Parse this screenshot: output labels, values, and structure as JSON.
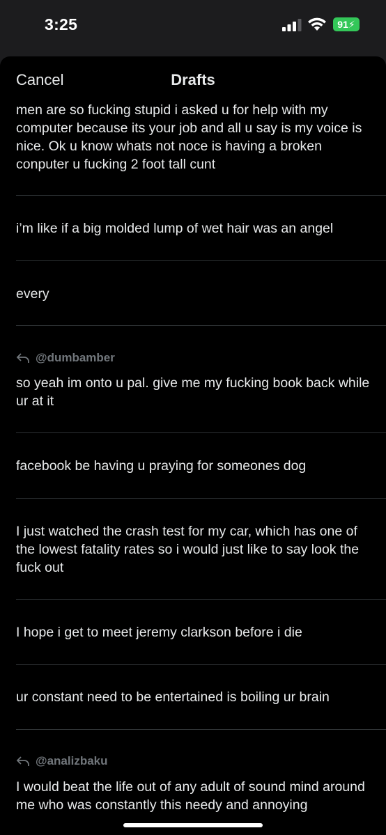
{
  "status_bar": {
    "time": "3:25",
    "battery": "91"
  },
  "nav": {
    "cancel_label": "Cancel",
    "title": "Drafts"
  },
  "drafts": [
    {
      "text": "men are so fucking stupid i asked u for help with my computer because its your job and all u say is my voice is nice. Ok u know whats not noce is having a broken conputer u fucking 2 foot tall cunt"
    },
    {
      "text": "i’m like if a big molded lump of wet hair was an angel"
    },
    {
      "text": "every"
    },
    {
      "reply_to": "@dumbamber",
      "text": "so yeah im onto u pal.  give me my fucking book back while ur at it"
    },
    {
      "text": "facebook be having u praying for someones dog"
    },
    {
      "text": "I just watched the crash test for my car, which has one of the lowest fatality rates so i would just like to say look the fuck out"
    },
    {
      "text": "I hope i get to meet jeremy clarkson before i die"
    },
    {
      "text": "ur constant need to be entertained is boiling ur brain"
    },
    {
      "reply_to": "@analizbaku",
      "text": "I would beat the life out of any adult of sound mind around me who was constantly this needy and annoying"
    }
  ],
  "colors": {
    "background": "#000000",
    "text": "#e7e9ea",
    "secondary_text": "#71767b",
    "divider": "#2f3336",
    "battery": "#34c759"
  }
}
